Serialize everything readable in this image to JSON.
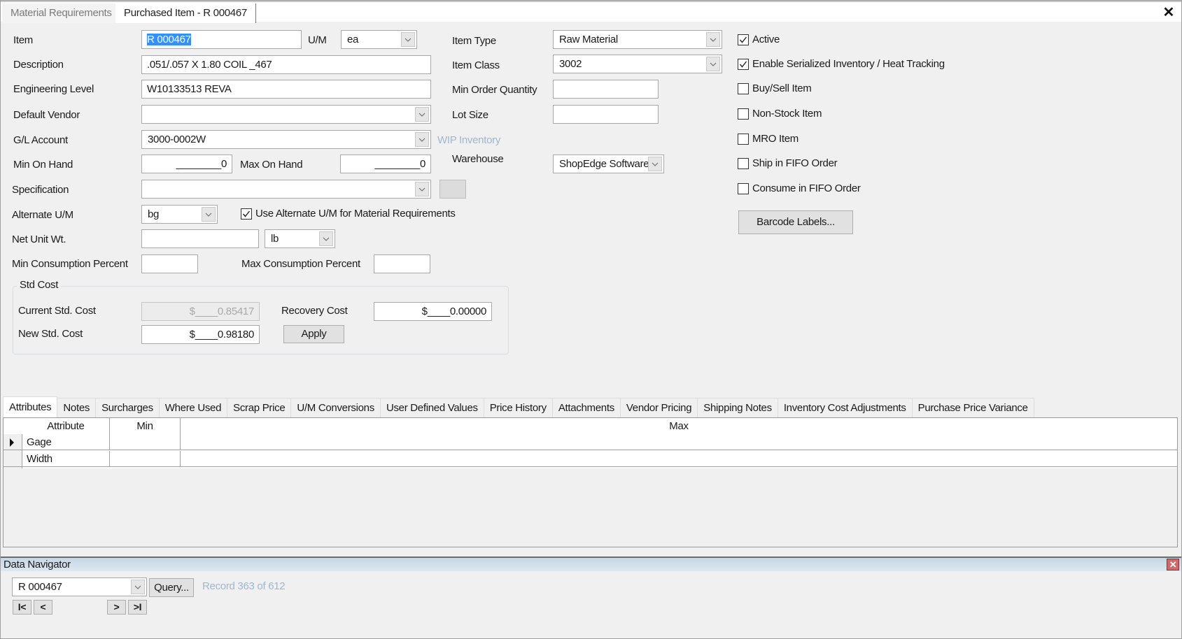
{
  "doc_tabs": [
    {
      "label": "Material Requirements",
      "active": false
    },
    {
      "label": "Purchased Item - R 000467",
      "active": true
    }
  ],
  "form": {
    "item": {
      "label": "Item",
      "value": "R 000467"
    },
    "um": {
      "label": "U/M",
      "value": "ea"
    },
    "description": {
      "label": "Description",
      "value": ".051/.057 X 1.80  COIL  _467"
    },
    "engineering_level": {
      "label": "Engineering Level",
      "value": "W10133513 REVA"
    },
    "default_vendor": {
      "label": "Default Vendor",
      "value": ""
    },
    "gl_account": {
      "label": "G/L Account",
      "value": "3000-0002W",
      "link": "WIP Inventory"
    },
    "min_on_hand": {
      "label": "Min On Hand",
      "value": "________0"
    },
    "max_on_hand": {
      "label": "Max On Hand",
      "value": "________0"
    },
    "specification": {
      "label": "Specification",
      "value": ""
    },
    "alternate_um": {
      "label": "Alternate U/M",
      "value": "bg"
    },
    "use_alt_um": {
      "label": "Use Alternate U/M for Material Requirements",
      "checked": true
    },
    "net_unit_wt": {
      "label": "Net Unit Wt.",
      "value": "",
      "unit": "lb"
    },
    "min_consumption": {
      "label": "Min Consumption Percent",
      "value": ""
    },
    "max_consumption": {
      "label": "Max Consumption Percent",
      "value": ""
    },
    "item_type": {
      "label": "Item Type",
      "value": "Raw Material"
    },
    "item_class": {
      "label": "Item Class",
      "value": "3002"
    },
    "min_order_qty": {
      "label": "Min Order Quantity",
      "value": ""
    },
    "lot_size": {
      "label": "Lot Size",
      "value": ""
    },
    "warehouse": {
      "label": "Warehouse",
      "value": "ShopEdge Software"
    }
  },
  "std_cost": {
    "title": "Std Cost",
    "current": {
      "label": "Current Std. Cost",
      "value": "$____0.85417"
    },
    "new": {
      "label": "New Std. Cost",
      "value": "$____0.98180"
    },
    "recovery": {
      "label": "Recovery Cost",
      "value": "$____0.00000"
    },
    "apply_label": "Apply"
  },
  "checkboxes": [
    {
      "label": "Active",
      "checked": true
    },
    {
      "label": "Enable Serialized Inventory / Heat Tracking",
      "checked": true
    },
    {
      "label": "Buy/Sell Item",
      "checked": false
    },
    {
      "label": "Non-Stock Item",
      "checked": false
    },
    {
      "label": "MRO Item",
      "checked": false
    },
    {
      "label": "Ship in FIFO Order",
      "checked": false
    },
    {
      "label": "Consume in FIFO Order",
      "checked": false
    }
  ],
  "barcode_label": "Barcode Labels...",
  "tabs": [
    {
      "label": "Attributes",
      "active": true
    },
    {
      "label": "Notes"
    },
    {
      "label": "Surcharges"
    },
    {
      "label": "Where Used"
    },
    {
      "label": "Scrap Price"
    },
    {
      "label": "U/M Conversions"
    },
    {
      "label": "User Defined Values"
    },
    {
      "label": "Price History"
    },
    {
      "label": "Attachments"
    },
    {
      "label": "Vendor Pricing"
    },
    {
      "label": "Shipping Notes"
    },
    {
      "label": "Inventory Cost Adjustments"
    },
    {
      "label": "Purchase Price Variance"
    }
  ],
  "grid": {
    "columns": [
      "Attribute",
      "Min",
      "Max"
    ],
    "rows": [
      {
        "attribute": "Gage",
        "min": "",
        "max": "",
        "current": true
      },
      {
        "attribute": "Width",
        "min": "",
        "max": ""
      }
    ]
  },
  "navigator": {
    "title": "Data Navigator",
    "record_value": "R 000467",
    "query_label": "Query...",
    "status": "Record 363 of 612",
    "first": "I<",
    "prev": "<",
    "next": ">",
    "last": ">I"
  }
}
